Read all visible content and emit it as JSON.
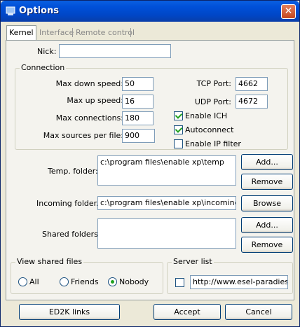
{
  "window": {
    "title": "Options",
    "icon": "app-icon"
  },
  "tabs": [
    "Kernel",
    "Interface",
    "Remote control"
  ],
  "kernel": {
    "nick_label": "Nick:",
    "nick_value": "",
    "connection": {
      "title": "Connection",
      "max_down_label": "Max down speed:",
      "max_down_value": "50",
      "max_up_label": "Max up speed:",
      "max_up_value": "16",
      "max_conn_label": "Max connections:",
      "max_conn_value": "180",
      "max_sources_label": "Max sources per file:",
      "max_sources_value": "900",
      "tcp_label": "TCP Port:",
      "tcp_value": "4662",
      "udp_label": "UDP Port:",
      "udp_value": "4672",
      "enable_ich_label": "Enable ICH",
      "enable_ich_checked": true,
      "autoconnect_label": "Autoconnect",
      "autoconnect_checked": true,
      "ip_filter_label": "Enable IP filter",
      "ip_filter_checked": false
    },
    "temp_folder": {
      "label": "Temp. folder:",
      "value": "c:\\program files\\enable xp\\temp",
      "add": "Add...",
      "remove": "Remove"
    },
    "incoming_folder": {
      "label": "Incoming folder.:",
      "value": "c:\\program files\\enable xp\\incoming",
      "browse": "Browse"
    },
    "shared_folders": {
      "label": "Shared folders:",
      "value": "",
      "add": "Add...",
      "remove": "Remove"
    },
    "view_shared": {
      "title": "View shared files",
      "options": [
        "All",
        "Friends",
        "Nobody"
      ],
      "selected": "Nobody"
    },
    "server_list": {
      "title": "Server list",
      "checked": false,
      "url": "http://www.esel-paradies.c"
    }
  },
  "footer": {
    "ed2k_links": "ED2K links",
    "accept": "Accept",
    "cancel": "Cancel"
  }
}
